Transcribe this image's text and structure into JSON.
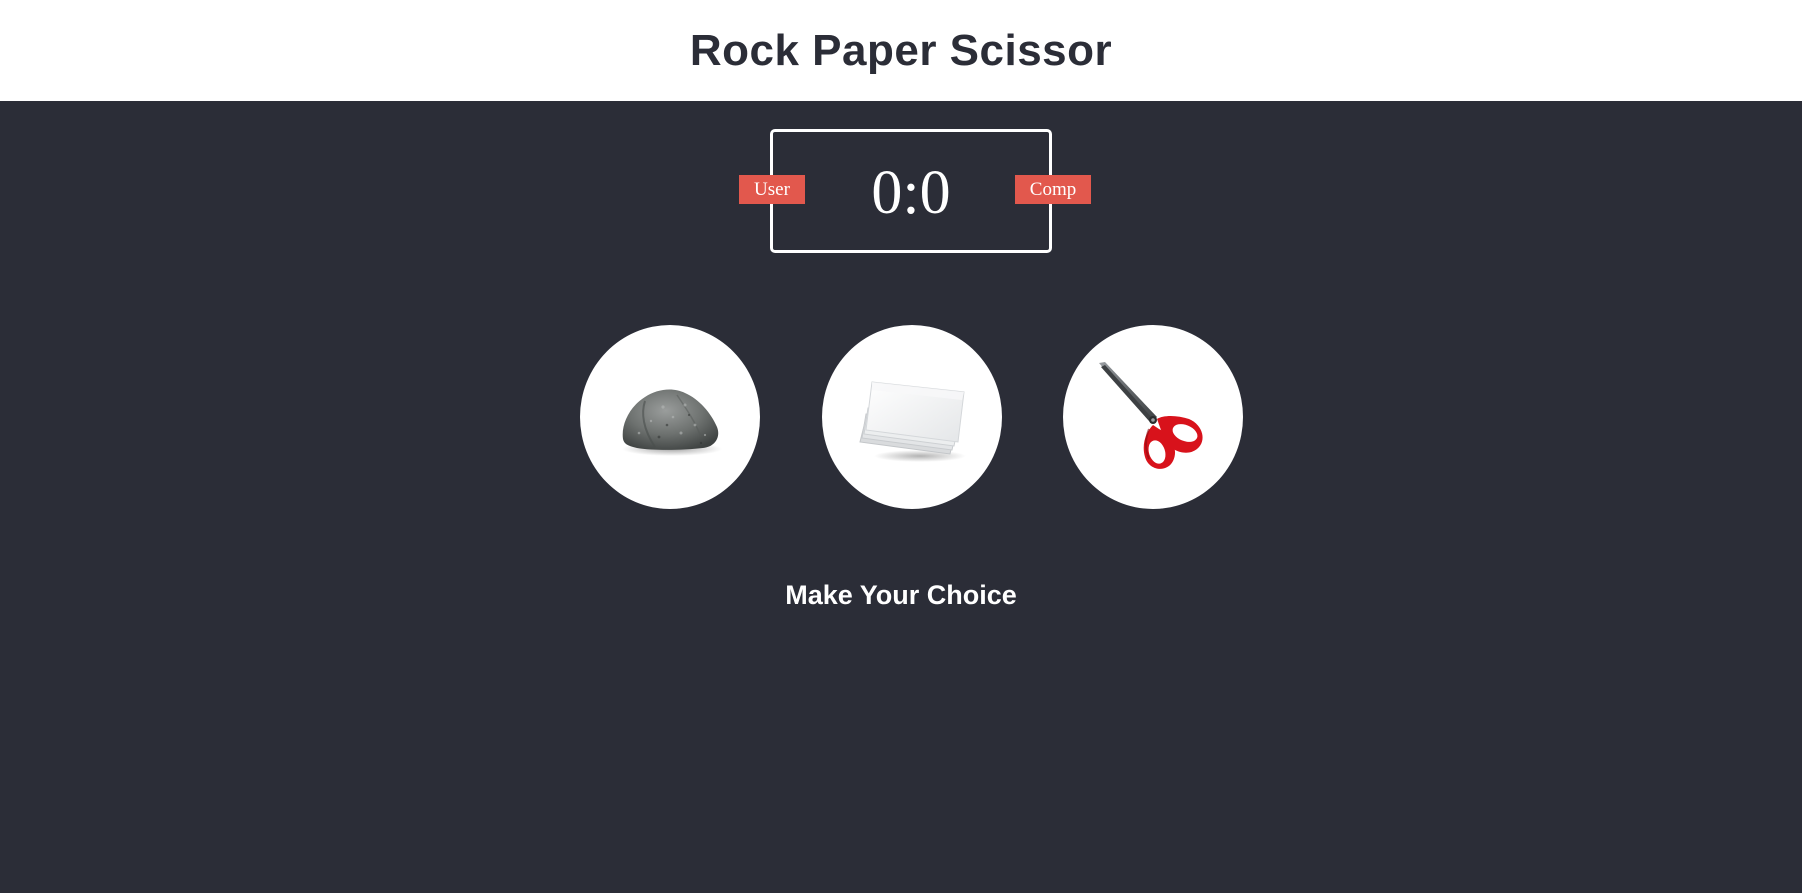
{
  "header": {
    "title": "Rock Paper Scissor"
  },
  "score": {
    "display": "0:0",
    "user_label": "User",
    "comp_label": "Comp"
  },
  "choices": [
    {
      "id": "rock",
      "icon": "rock-icon"
    },
    {
      "id": "paper",
      "icon": "paper-icon"
    },
    {
      "id": "scissors",
      "icon": "scissors-icon"
    }
  ],
  "message": "Make Your Choice",
  "colors": {
    "background": "#2b2d37",
    "header_background": "#ffffff",
    "badge": "#e2584d",
    "text_light": "#ffffff",
    "title_text": "#2b2d37",
    "scissors_handle": "#d8121b"
  }
}
